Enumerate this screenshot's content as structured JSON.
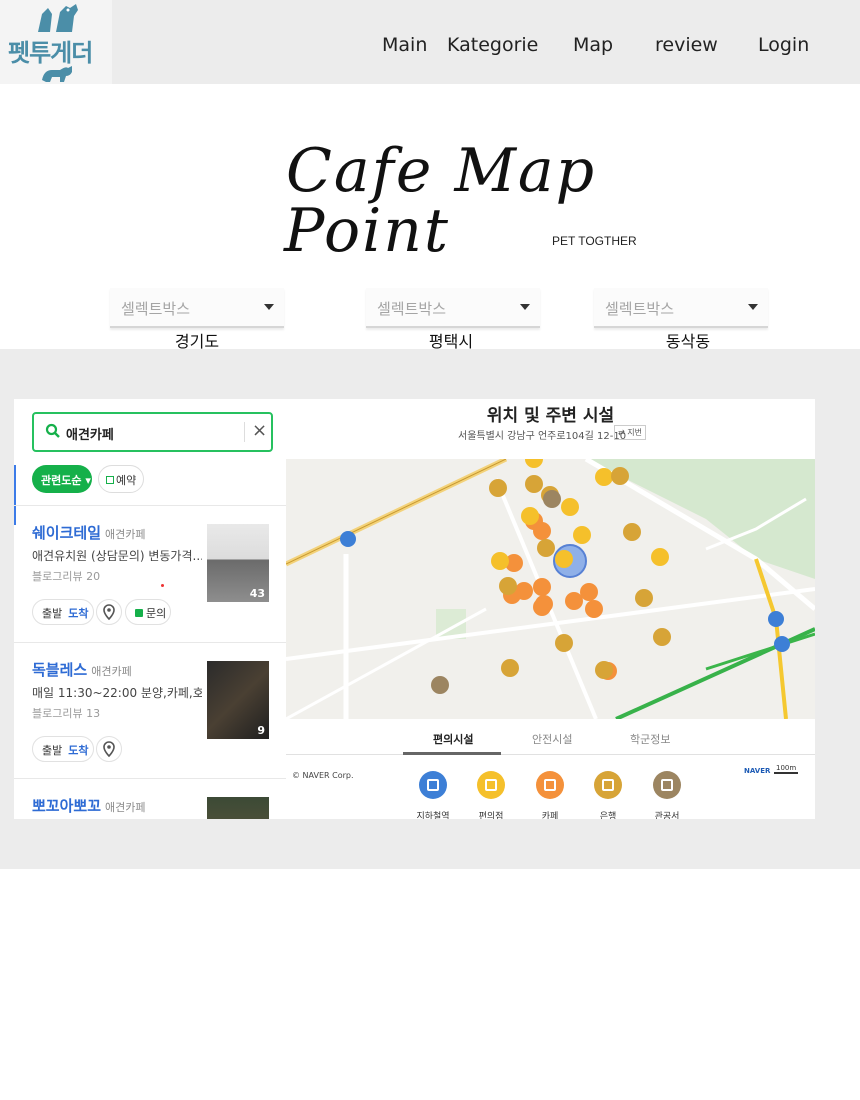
{
  "header": {
    "logo_text": "펫투게더",
    "nav": [
      "Main",
      "Kategorie",
      "Map",
      "review",
      "Login"
    ]
  },
  "hero": {
    "title_line1": "Cafe Map",
    "title_line2": "Point",
    "subtitle": "PET TOGTHER"
  },
  "filters": [
    {
      "placeholder": "셀렉트박스",
      "region": "경기도"
    },
    {
      "placeholder": "셀렉트박스",
      "region": "평택시"
    },
    {
      "placeholder": "셀렉트박스",
      "region": "동삭동"
    }
  ],
  "list_panel": {
    "search_query": "애견카페",
    "sort_label": "관련도순",
    "reserve_label": "예약",
    "places": [
      {
        "name": "쉐이크테일",
        "category": "애견카페",
        "desc": "애견유치원 (상담문의) 변동가격...",
        "review": "블로그리뷰 20",
        "photo_count": "43",
        "depart": "출발",
        "arrive": "도착",
        "inquiry": "문의"
      },
      {
        "name": "독블레스",
        "category": "애견카페",
        "desc": "매일 11:30~22:00 분양,카페,호...",
        "review": "블로그리뷰 13",
        "photo_count": "9",
        "depart": "출발",
        "arrive": "도착"
      },
      {
        "name": "뽀꼬아뽀꼬",
        "category": "애견카페"
      }
    ]
  },
  "map_panel": {
    "title": "위치 및 주변 시설",
    "address": "서울특별시 강남구 언주로104길 12-10",
    "copy_label": "지번",
    "copyright": "© NAVER Corp.",
    "brand": "NAVER",
    "scale": "100m",
    "tabs": [
      "편의시설",
      "안전시설",
      "학군정보"
    ],
    "active_tab": "편의시설",
    "facilities": [
      {
        "label": "지하철역",
        "color": "#3d7fd6"
      },
      {
        "label": "편의점",
        "color": "#f5c02b"
      },
      {
        "label": "카페",
        "color": "#f4913b"
      },
      {
        "label": "은행",
        "color": "#d7a437"
      },
      {
        "label": "관공서",
        "color": "#9c8561"
      }
    ]
  },
  "colors": {
    "header_bg": "#ececec",
    "logo_blue": "#4b8ea8",
    "search_green": "#26c15f",
    "place_blue": "#2e6bd4"
  }
}
